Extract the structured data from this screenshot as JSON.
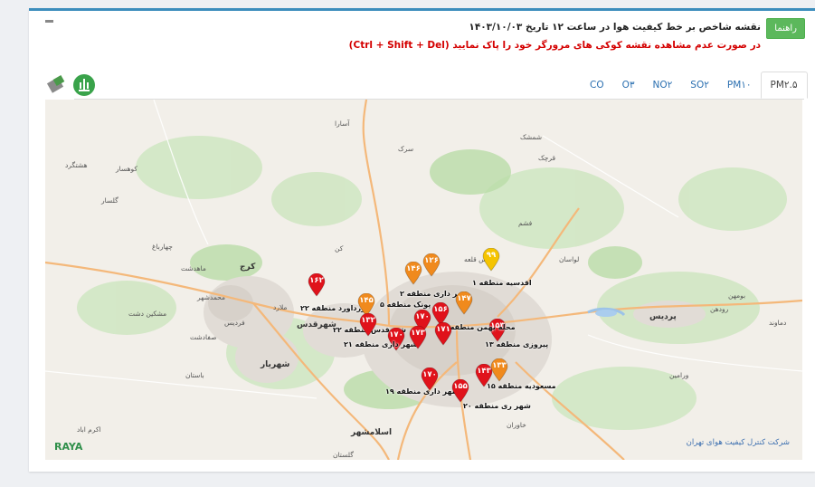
{
  "header": {
    "guide_button": "راهنما",
    "title": "نقشه شاخص بر خط کیفیت هوا در ساعت ۱۲ تاریخ ۱۴۰۳/۱۰/۰۳",
    "warning": "در صورت عدم مشاهده نقشه کوکی های مرورگر خود را پاک نمایید (Ctrl + Shift + Del)"
  },
  "tabs": [
    {
      "label": "CO",
      "active": false
    },
    {
      "label": "O۳",
      "active": false
    },
    {
      "label": "NO۲",
      "active": false
    },
    {
      "label": "SO۲",
      "active": false
    },
    {
      "label": "PM۱۰",
      "active": false
    },
    {
      "label": "PM۲.۵",
      "active": true
    }
  ],
  "colors": {
    "accent": "#3c8dbc",
    "green": "#5cb85c",
    "red_pin": "#e0121b",
    "orange_pin": "#f08a1d",
    "yellow_pin": "#f5c400",
    "warning_text": "#d40000"
  },
  "map": {
    "places": [
      {
        "name": "هشتگرد"
      },
      {
        "name": "کوهسار"
      },
      {
        "name": "گلسار"
      },
      {
        "name": "چهارباغ"
      },
      {
        "name": "ماهدشت"
      },
      {
        "name": "کرج"
      },
      {
        "name": "محمدشهر"
      },
      {
        "name": "مشکین دشت"
      },
      {
        "name": "فردیس"
      },
      {
        "name": "شهرقدس"
      },
      {
        "name": "ملارد"
      },
      {
        "name": "شهریار"
      },
      {
        "name": "صفادشت"
      },
      {
        "name": "باستان"
      },
      {
        "name": "اسلامشهر"
      },
      {
        "name": "گلستان"
      },
      {
        "name": "اکرم اباد"
      },
      {
        "name": "پردیس"
      },
      {
        "name": "رودهن"
      },
      {
        "name": "لواسان"
      },
      {
        "name": "فشم"
      },
      {
        "name": "پس قلعه"
      },
      {
        "name": "آسارا"
      },
      {
        "name": "شمشک"
      },
      {
        "name": "قرچک"
      },
      {
        "name": "ورامین"
      },
      {
        "name": "خاوران"
      },
      {
        "name": "بومهن"
      },
      {
        "name": "دماوند"
      },
      {
        "name": "کن"
      },
      {
        "name": "سرک"
      }
    ],
    "stations": [
      {
        "value": "۹۹",
        "label": "اقدسیه منطقه ۱",
        "level": "yellow"
      },
      {
        "value": "۱۲۶",
        "label": "شهر داری منطقه ۲",
        "level": "orange"
      },
      {
        "value": "۱۴۶",
        "label": "",
        "level": "orange"
      },
      {
        "value": "۱۵۶",
        "label": "پونک منطقه ۵",
        "level": "red"
      },
      {
        "value": "۱۶۲",
        "label": "ورداورد منطقه ۲۲",
        "level": "red"
      },
      {
        "value": "۱۴۵",
        "label": "شهرقدس منطقه ۲۲",
        "level": "orange"
      },
      {
        "value": "۱۴۷",
        "label": "",
        "level": "orange"
      },
      {
        "value": "۱۵۳",
        "label": "محله بهمن منطقه ۷",
        "level": "red"
      },
      {
        "value": "۱۳۲",
        "label": "",
        "level": "red"
      },
      {
        "value": "۱۷۰",
        "label": "",
        "level": "red"
      },
      {
        "value": "۱۷۰",
        "label": "شهر داری منطقه ۲۱",
        "level": "red"
      },
      {
        "value": "۱۷۳",
        "label": "",
        "level": "red"
      },
      {
        "value": "۱۷۱",
        "label": "",
        "level": "red"
      },
      {
        "value": "۱۴۳",
        "label": "پیروزی منطقه ۱۳",
        "level": "red"
      },
      {
        "value": "۱۳۳",
        "label": "مسعودیه منطقه ۱۵",
        "level": "orange"
      },
      {
        "value": "۱۷۰",
        "label": "شهر داری منطقه ۱۹",
        "level": "red"
      },
      {
        "value": "۱۵۵",
        "label": "شهر ری منطقه ۲۰",
        "level": "red"
      }
    ],
    "brand": "RAYA",
    "credit": "شرکت کنترل کیفیت هوای تهران"
  }
}
